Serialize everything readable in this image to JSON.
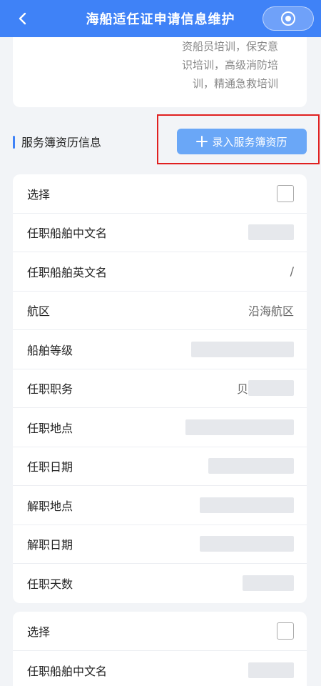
{
  "header": {
    "title": "海船适任证申请信息维护",
    "back_icon": "chevron-left-icon",
    "capsule_icon": "target-icon"
  },
  "top_card": {
    "lines": [
      "资船员培训，保安意",
      "识培训，高级消防培",
      "训，精通急救培训"
    ]
  },
  "section": {
    "title": "服务簿资历信息",
    "add_button_label": "录入服务簿资历"
  },
  "record1": {
    "select_label": "选择",
    "ship_cn_label": "任职船舶中文名",
    "ship_en_label": "任职船舶英文名",
    "ship_en_value": "/",
    "area_label": "航区",
    "area_value": "沿海航区",
    "grade_label": "船舶等级",
    "duty_label": "任职职务",
    "duty_value": "贝",
    "place_label": "任职地点",
    "date_label": "任职日期",
    "leave_place_label": "解职地点",
    "leave_date_label": "解职日期",
    "days_label": "任职天数"
  },
  "record2": {
    "select_label": "选择",
    "ship_cn_label": "任职船舶中文名"
  },
  "colors": {
    "primary": "#3f82f7",
    "button": "#6aa7f7",
    "highlight_border": "#e02020"
  }
}
